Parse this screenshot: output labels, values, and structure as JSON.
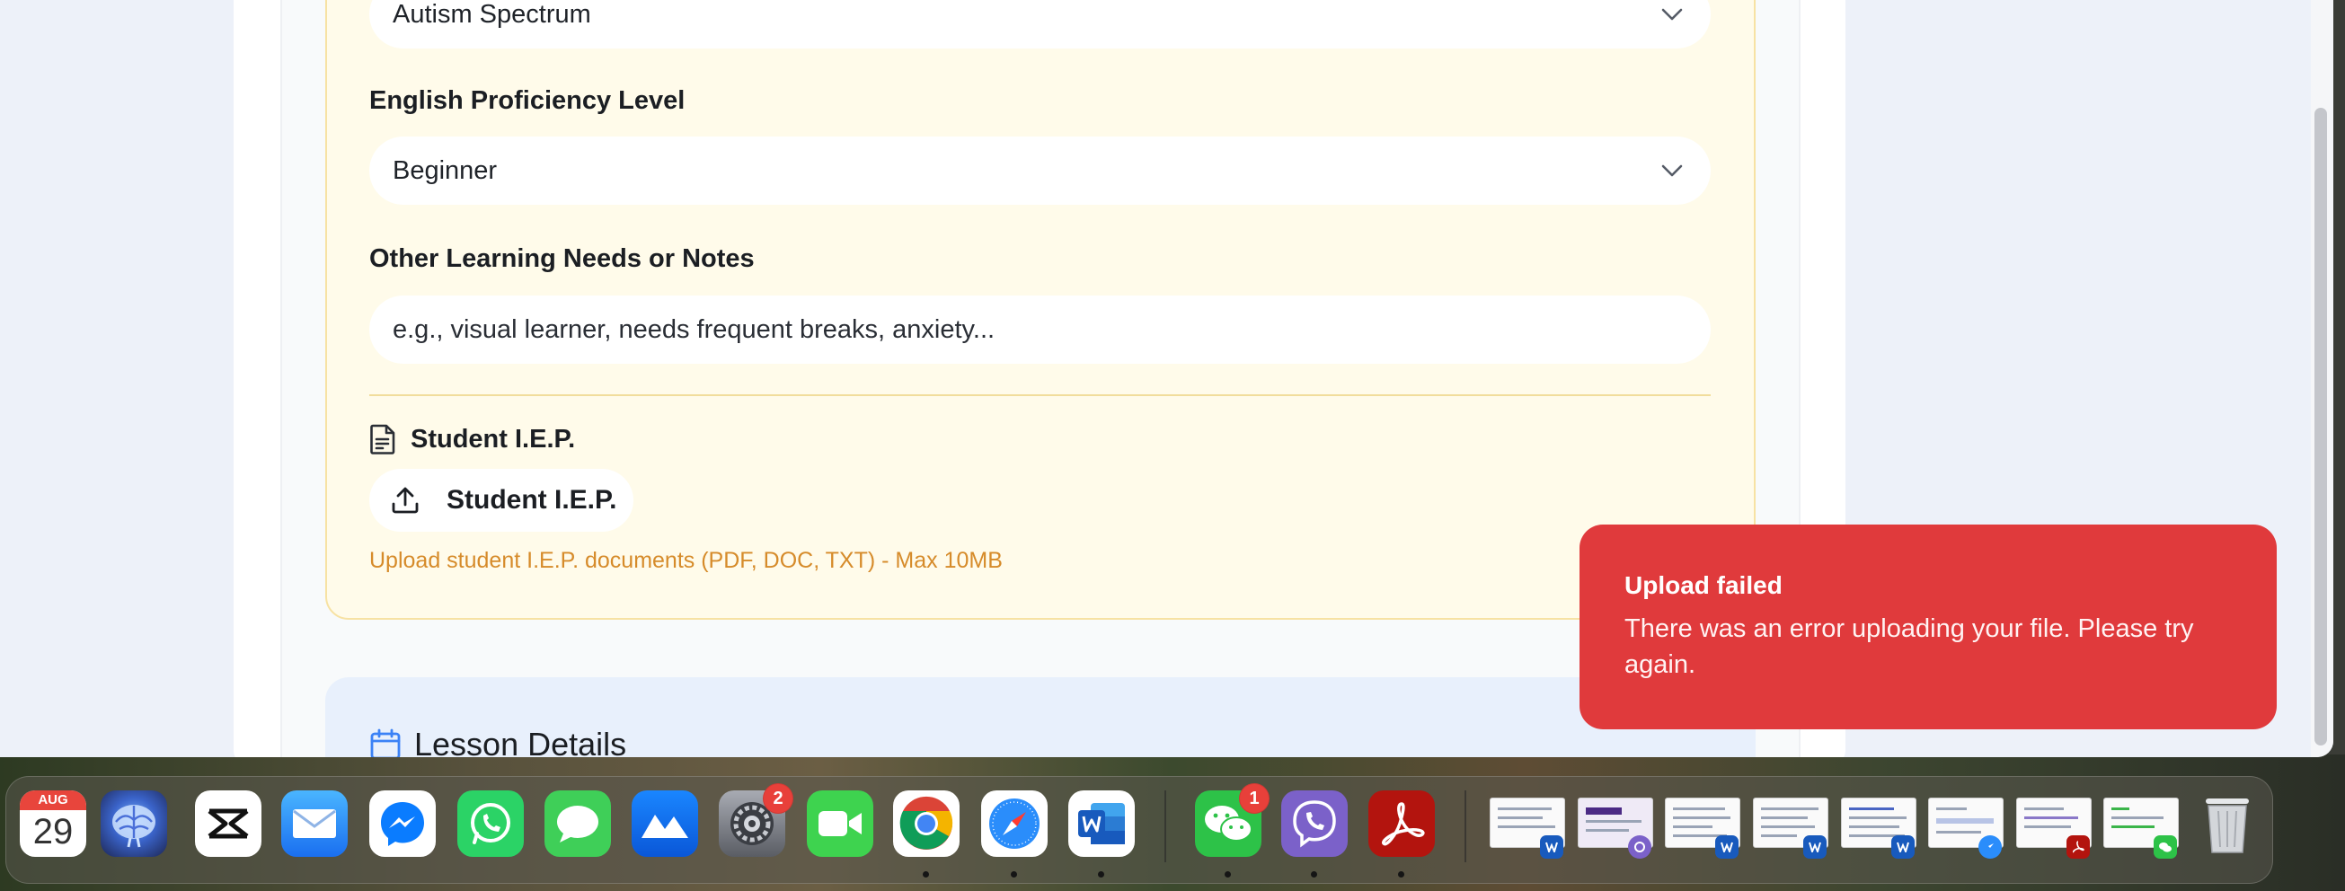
{
  "form": {
    "disability_select": {
      "value": "Autism Spectrum"
    },
    "english_proficiency": {
      "label": "English Proficiency Level",
      "value": "Beginner"
    },
    "other_needs": {
      "label": "Other Learning Needs or Notes",
      "placeholder": "e.g., visual learner, needs frequent breaks, anxiety..."
    },
    "iep": {
      "title": "Student I.E.P.",
      "upload_label": "Student I.E.P.",
      "hint": "Upload student I.E.P. documents (PDF, DOC, TXT) - Max 10MB"
    },
    "lesson_details": {
      "title": "Lesson Details"
    }
  },
  "toast": {
    "title": "Upload failed",
    "message": "There was an error uploading your file. Please try again."
  },
  "dock": {
    "calendar": {
      "month": "AUG",
      "day": "29"
    },
    "badges": {
      "system_settings": "2",
      "wechat": "1"
    },
    "apps": [
      "Calendar",
      "Brain App",
      "CapCut",
      "Mail",
      "Messenger",
      "WhatsApp",
      "Messages",
      "Maps App",
      "System Settings",
      "FaceTime",
      "Chrome",
      "Safari",
      "Word",
      "WeChat",
      "Viber",
      "Acrobat",
      "Trash"
    ]
  },
  "colors": {
    "toast_bg": "#e03a3c",
    "section_bg": "#fffbea",
    "section_border": "#f7e2a3",
    "hint_text": "#d68b2a",
    "accent_blue": "#3b82f6"
  }
}
